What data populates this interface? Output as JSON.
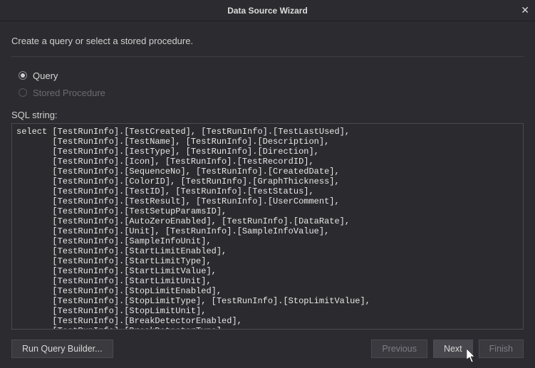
{
  "titlebar": {
    "title": "Data Source Wizard",
    "close_glyph": "✕"
  },
  "intro": "Create a query or select a stored procedure.",
  "radios": {
    "query": "Query",
    "stored_proc": "Stored Procedure"
  },
  "sql_label": "SQL string:",
  "sql_text": "select [TestRunInfo].[TestCreated], [TestRunInfo].[TestLastUsed],\n       [TestRunInfo].[TestName], [TestRunInfo].[Description],\n       [TestRunInfo].[IestType], [TestRunInfo].[Direction],\n       [TestRunInfo].[Icon], [TestRunInfo].[TestRecordID],\n       [TestRunInfo].[SequenceNo], [TestRunInfo].[CreatedDate],\n       [TestRunInfo].[ColorID], [TestRunInfo].[GraphThickness],\n       [TestRunInfo].[TestID], [TestRunInfo].[TestStatus],\n       [TestRunInfo].[TestResult], [TestRunInfo].[UserComment],\n       [TestRunInfo].[TestSetupParamsID],\n       [TestRunInfo].[AutoZeroEnabled], [TestRunInfo].[DataRate],\n       [TestRunInfo].[Unit], [TestRunInfo].[SampleInfoValue],\n       [TestRunInfo].[SampleInfoUnit],\n       [TestRunInfo].[StartLimitEnabled],\n       [TestRunInfo].[StartLimitType],\n       [TestRunInfo].[StartLimitValue],\n       [TestRunInfo].[StartLimitUnit],\n       [TestRunInfo].[StopLimitEnabled],\n       [TestRunInfo].[StopLimitType], [TestRunInfo].[StopLimitValue],\n       [TestRunInfo].[StopLimitUnit],\n       [TestRunInfo].[BreakDetectorEnabled],\n       [TestRunInfo].[BreakDetectorType],",
  "footer": {
    "run_query_builder": "Run Query Builder...",
    "previous": "Previous",
    "next": "Next",
    "finish": "Finish"
  }
}
